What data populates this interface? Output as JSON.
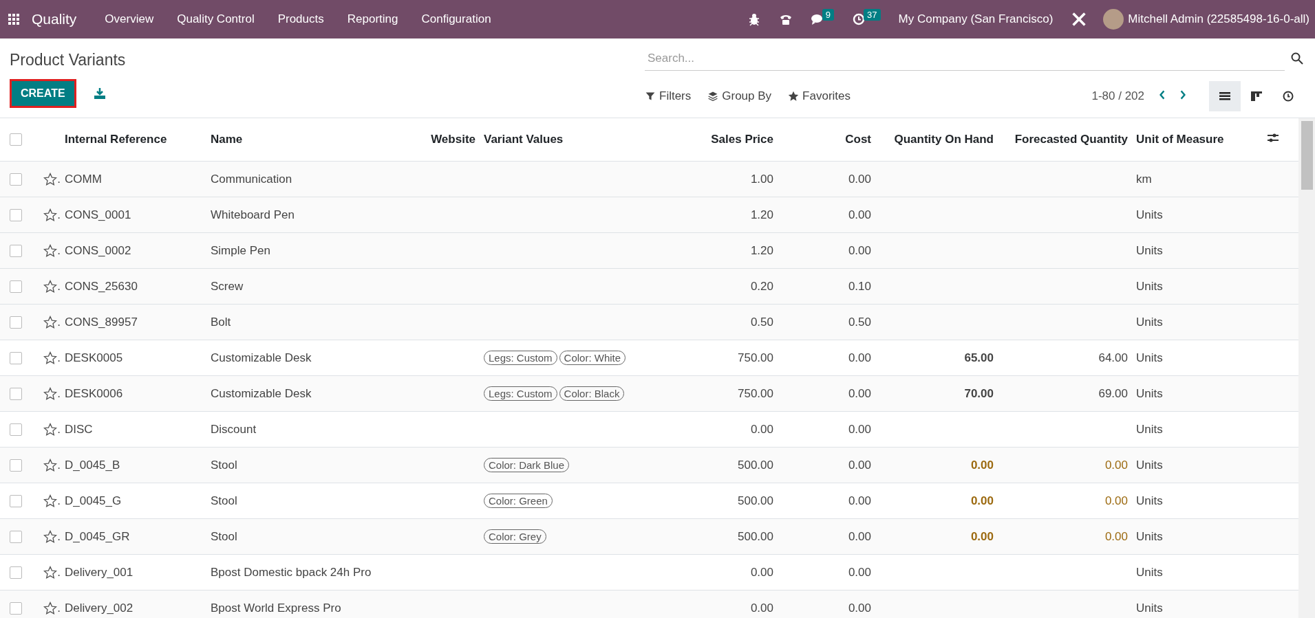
{
  "navbar": {
    "app_name": "Quality",
    "menu": [
      "Overview",
      "Quality Control",
      "Products",
      "Reporting",
      "Configuration"
    ],
    "messages_badge": "9",
    "activities_badge": "37",
    "company": "My Company (San Francisco)",
    "user": "Mitchell Admin (22585498-16-0-all)"
  },
  "control_panel": {
    "title": "Product Variants",
    "create_label": "CREATE",
    "search": {
      "placeholder": "Search..."
    },
    "filters": "Filters",
    "group_by": "Group By",
    "favorites": "Favorites",
    "pager": "1-80 / 202",
    "views": [
      {
        "kind": "list",
        "selected": true
      },
      {
        "kind": "kanban",
        "selected": false
      },
      {
        "kind": "activity",
        "selected": false
      }
    ]
  },
  "table": {
    "select_all_checked": false,
    "columns": [
      "Internal Reference",
      "Name",
      "Website",
      "Variant Values",
      "Sales Price",
      "Cost",
      "Quantity On Hand",
      "Forecasted Quantity",
      "Unit of Measure"
    ],
    "rows": [
      {
        "checked": false,
        "favorite": false,
        "mark": ".",
        "reference": "COMM",
        "name": "Communication",
        "variants": [],
        "sales_price": "1.00",
        "cost": "0.00",
        "on_hand": "",
        "forecast": "",
        "uom": "km",
        "warning": false
      },
      {
        "checked": false,
        "favorite": false,
        "mark": ".",
        "reference": "CONS_0001",
        "name": "Whiteboard Pen",
        "variants": [],
        "sales_price": "1.20",
        "cost": "0.00",
        "on_hand": "",
        "forecast": "",
        "uom": "Units",
        "warning": false
      },
      {
        "checked": false,
        "favorite": false,
        "mark": ".",
        "reference": "CONS_0002",
        "name": "Simple Pen",
        "variants": [],
        "sales_price": "1.20",
        "cost": "0.00",
        "on_hand": "",
        "forecast": "",
        "uom": "Units",
        "warning": false
      },
      {
        "checked": false,
        "favorite": false,
        "mark": ".",
        "reference": "CONS_25630",
        "name": "Screw",
        "variants": [],
        "sales_price": "0.20",
        "cost": "0.10",
        "on_hand": "",
        "forecast": "",
        "uom": "Units",
        "warning": false
      },
      {
        "checked": false,
        "favorite": false,
        "mark": ".",
        "reference": "CONS_89957",
        "name": "Bolt",
        "variants": [],
        "sales_price": "0.50",
        "cost": "0.50",
        "on_hand": "",
        "forecast": "",
        "uom": "Units",
        "warning": false
      },
      {
        "checked": false,
        "favorite": false,
        "mark": ".",
        "reference": "DESK0005",
        "name": "Customizable Desk",
        "variants": [
          "Legs: Custom",
          "Color: White"
        ],
        "sales_price": "750.00",
        "cost": "0.00",
        "on_hand": "65.00",
        "forecast": "64.00",
        "uom": "Units",
        "warning": false
      },
      {
        "checked": false,
        "favorite": false,
        "mark": ".",
        "reference": "DESK0006",
        "name": "Customizable Desk",
        "variants": [
          "Legs: Custom",
          "Color: Black"
        ],
        "sales_price": "750.00",
        "cost": "0.00",
        "on_hand": "70.00",
        "forecast": "69.00",
        "uom": "Units",
        "warning": false
      },
      {
        "checked": false,
        "favorite": false,
        "mark": ".",
        "reference": "DISC",
        "name": "Discount",
        "variants": [],
        "sales_price": "0.00",
        "cost": "0.00",
        "on_hand": "",
        "forecast": "",
        "uom": "Units",
        "warning": false
      },
      {
        "checked": false,
        "favorite": false,
        "mark": ".",
        "reference": "D_0045_B",
        "name": "Stool",
        "variants": [
          "Color: Dark Blue"
        ],
        "sales_price": "500.00",
        "cost": "0.00",
        "on_hand": "0.00",
        "forecast": "0.00",
        "uom": "Units",
        "warning": true
      },
      {
        "checked": false,
        "favorite": false,
        "mark": ".",
        "reference": "D_0045_G",
        "name": "Stool",
        "variants": [
          "Color: Green"
        ],
        "sales_price": "500.00",
        "cost": "0.00",
        "on_hand": "0.00",
        "forecast": "0.00",
        "uom": "Units",
        "warning": true
      },
      {
        "checked": false,
        "favorite": false,
        "mark": ".",
        "reference": "D_0045_GR",
        "name": "Stool",
        "variants": [
          "Color: Grey"
        ],
        "sales_price": "500.00",
        "cost": "0.00",
        "on_hand": "0.00",
        "forecast": "0.00",
        "uom": "Units",
        "warning": true
      },
      {
        "checked": false,
        "favorite": false,
        "mark": ".",
        "reference": "Delivery_001",
        "name": "Bpost Domestic bpack 24h Pro",
        "variants": [],
        "sales_price": "0.00",
        "cost": "0.00",
        "on_hand": "",
        "forecast": "",
        "uom": "Units",
        "warning": false
      },
      {
        "checked": false,
        "favorite": false,
        "mark": ".",
        "reference": "Delivery_002",
        "name": "Bpost World Express Pro",
        "variants": [],
        "sales_price": "0.00",
        "cost": "0.00",
        "on_hand": "",
        "forecast": "",
        "uom": "Units",
        "warning": false
      }
    ]
  }
}
